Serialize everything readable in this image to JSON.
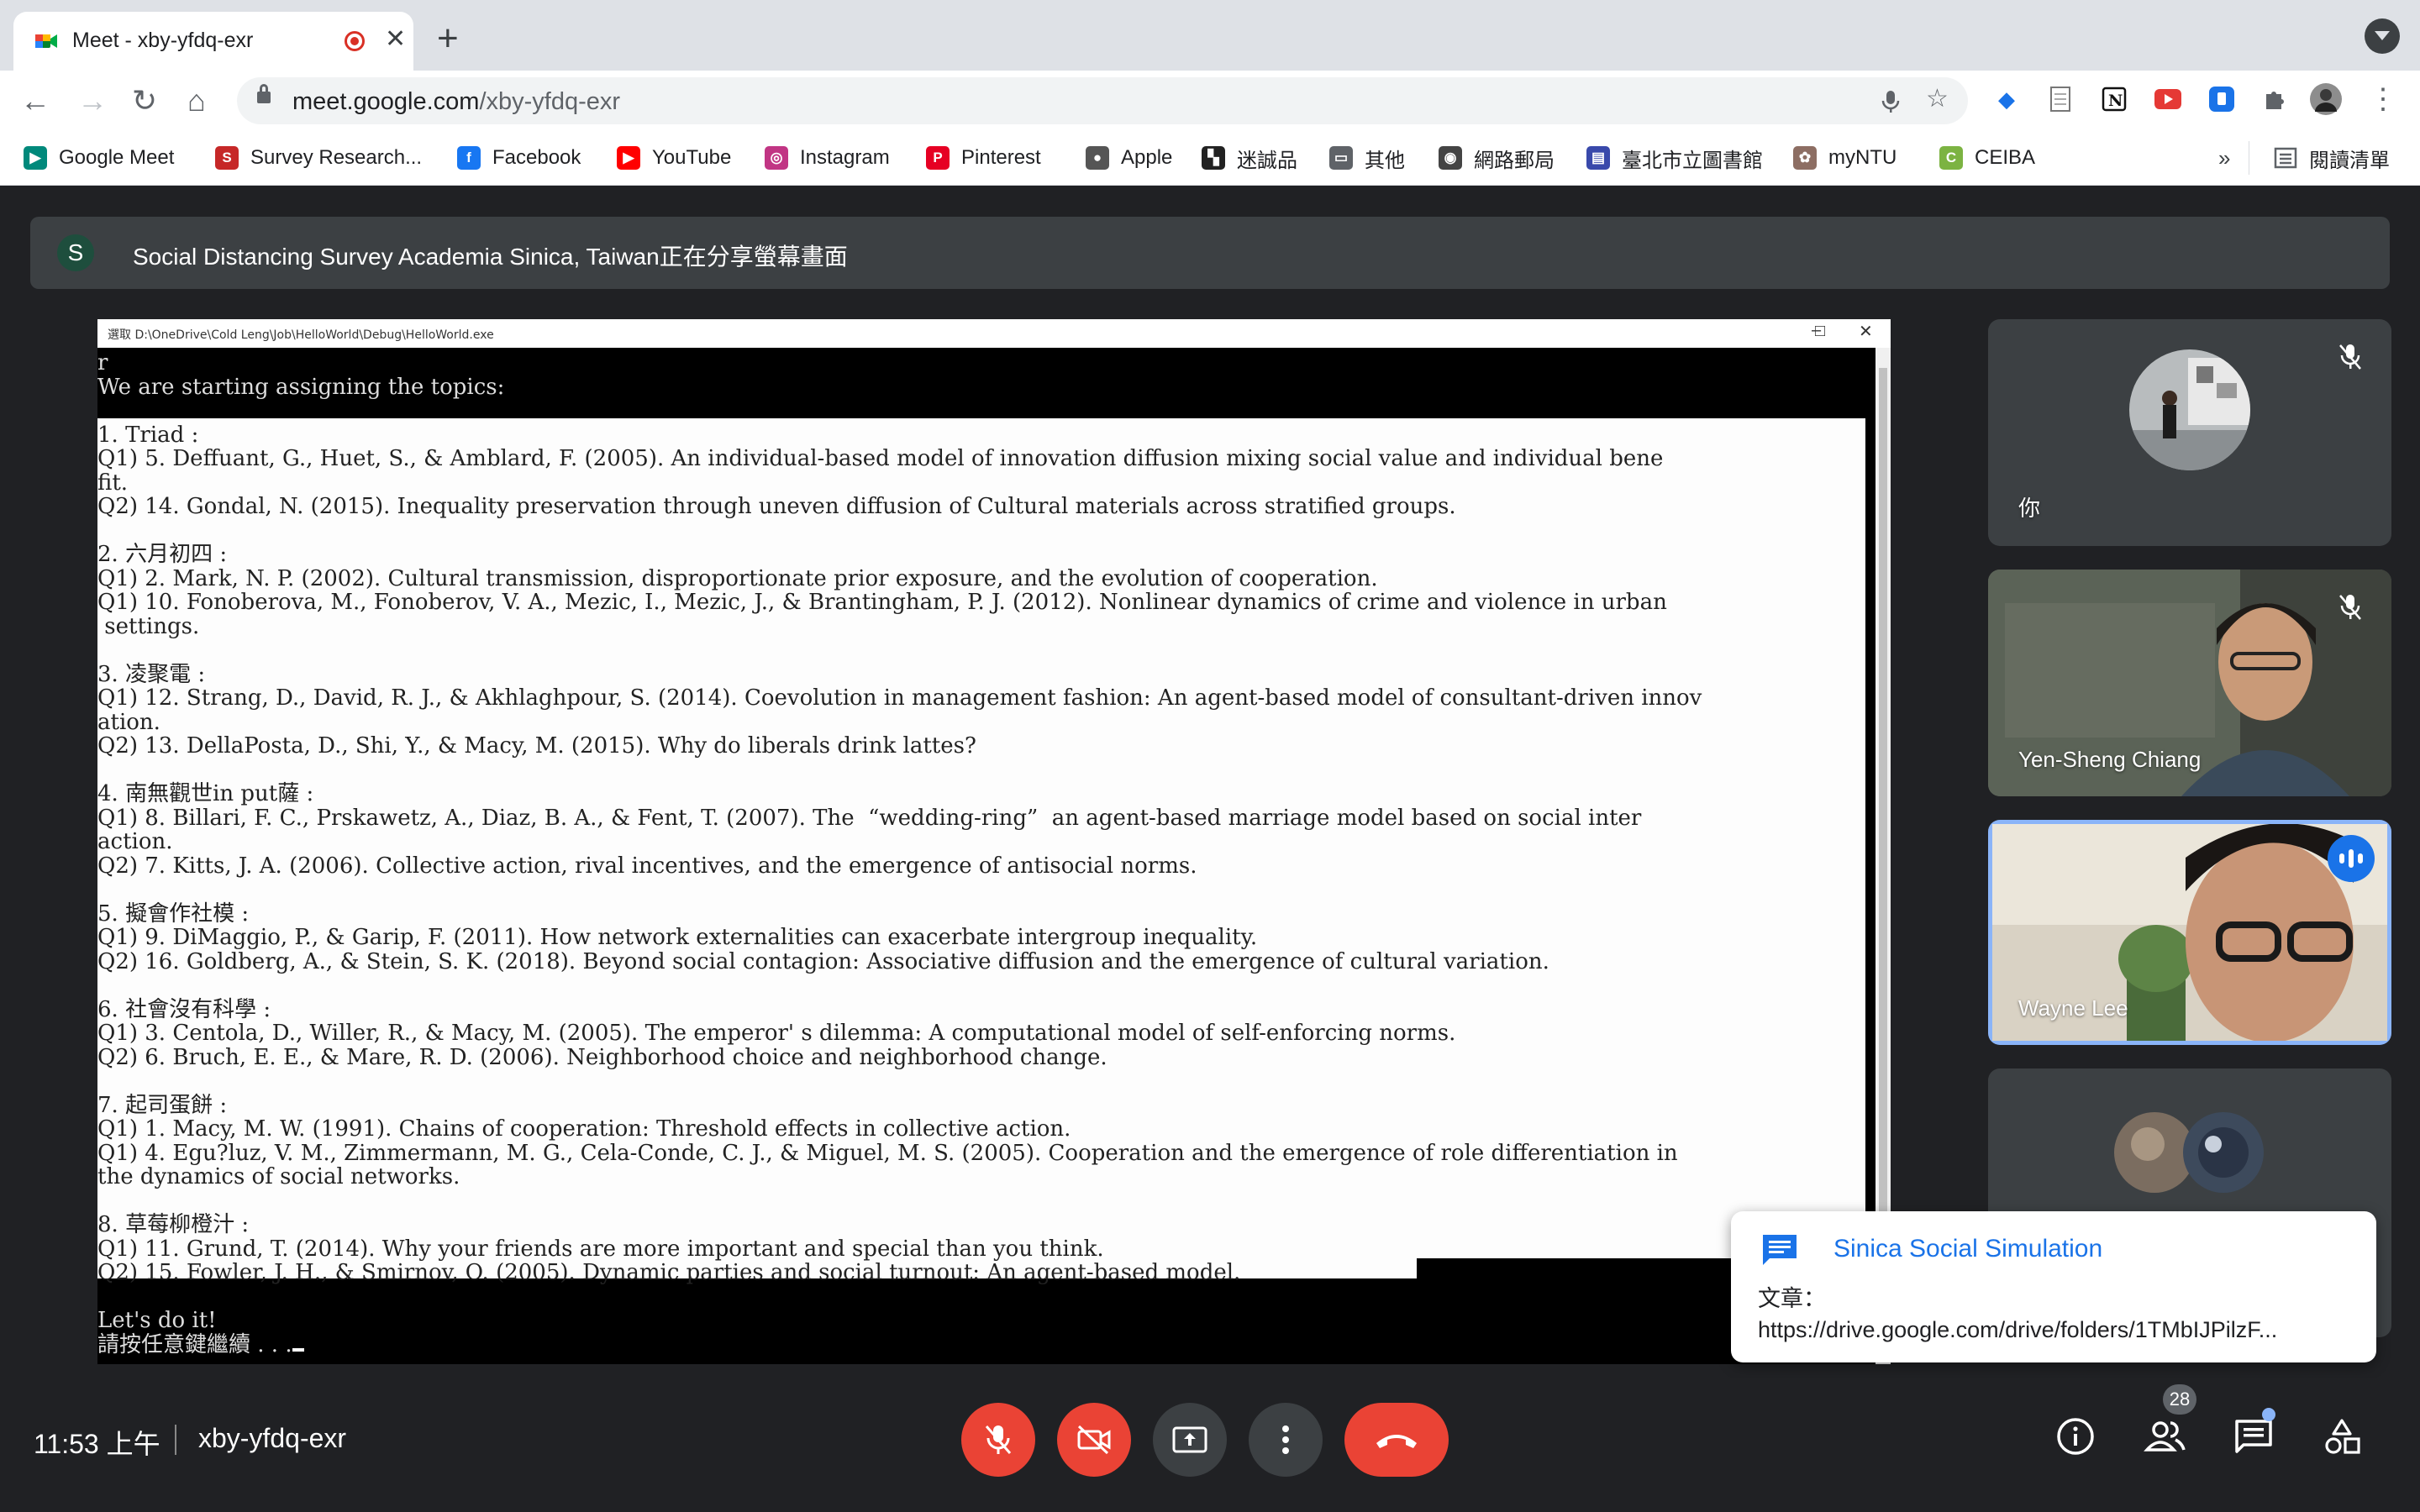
{
  "browser": {
    "tab_title": "Meet - xby-yfdq-exr",
    "new_tab": "+",
    "url_host": "meet.google.com",
    "url_path": "/xby-yfdq-exr"
  },
  "bookmarks": [
    {
      "label": "Google Meet",
      "icon": "meet-icon",
      "color": "#00897b"
    },
    {
      "label": "Survey Research...",
      "icon": "survey-icon",
      "color": "#c62828"
    },
    {
      "label": "Facebook",
      "icon": "facebook-icon",
      "color": "#1877f2"
    },
    {
      "label": "YouTube",
      "icon": "youtube-icon",
      "color": "#ff0000"
    },
    {
      "label": "Instagram",
      "icon": "instagram-icon",
      "color": "#c13584"
    },
    {
      "label": "Pinterest",
      "icon": "pinterest-icon",
      "color": "#e60023"
    },
    {
      "label": "Apple",
      "icon": "apple-icon",
      "color": "#555555"
    },
    {
      "label": "迷誠品",
      "icon": "eslite-icon",
      "color": "#222222"
    },
    {
      "label": "其他",
      "icon": "folder-icon",
      "color": "#5f6368"
    },
    {
      "label": "網路郵局",
      "icon": "globe-icon",
      "color": "#444444"
    },
    {
      "label": "臺北市立圖書館",
      "icon": "library-icon",
      "color": "#3949ab"
    },
    {
      "label": "myNTU",
      "icon": "ntu-icon",
      "color": "#8d6e63"
    },
    {
      "label": "CEIBA",
      "icon": "ceiba-icon",
      "color": "#7cb342"
    }
  ],
  "bookmarks_more": "»",
  "reading_list": "閱讀清單",
  "presentation": {
    "avatar_letter": "S",
    "banner": "Social Distancing Survey Academia Sinica, Taiwan正在分享螢幕畫面"
  },
  "console": {
    "title": "選取 D:\\OneDrive\\Cold Leng\\Job\\HelloWorld\\Debug\\HelloWorld.exe",
    "lines": [
      "r",
      "We are starting assigning the topics:",
      "",
      "1. Triad :",
      "Q1) 5. Deffuant, G., Huet, S., & Amblard, F. (2005). An individual-based model of innovation diffusion mixing social value and individual bene",
      "fit.",
      "Q2) 14. Gondal, N. (2015). Inequality preservation through uneven diffusion of Cultural materials across stratified groups.",
      "",
      "2. 六月初四 :",
      "Q1) 2. Mark, N. P. (2002). Cultural transmission, disproportionate prior exposure, and the evolution of cooperation.",
      "Q1) 10. Fonoberova, M., Fonoberov, V. A., Mezic, I., Mezic, J., & Brantingham, P. J. (2012). Nonlinear dynamics of crime and violence in urban",
      " settings.",
      "",
      "3. 凌聚電 :",
      "Q1) 12. Strang, D., David, R. J., & Akhlaghpour, S. (2014). Coevolution in management fashion: An agent-based model of consultant-driven innov",
      "ation.",
      "Q2) 13. DellaPosta, D., Shi, Y., & Macy, M. (2015). Why do liberals drink lattes?",
      "",
      "4. 南無觀世in put薩 :",
      "Q1) 8. Billari, F. C., Prskawetz, A., Diaz, B. A., & Fent, T. (2007). The  “wedding-ring”  an agent-based marriage model based on social inter",
      "action.",
      "Q2) 7. Kitts, J. A. (2006). Collective action, rival incentives, and the emergence of antisocial norms.",
      "",
      "5. 擬會作社模 :",
      "Q1) 9. DiMaggio, P., & Garip, F. (2011). How network externalities can exacerbate intergroup inequality.",
      "Q2) 16. Goldberg, A., & Stein, S. K. (2018). Beyond social contagion: Associative diffusion and the emergence of cultural variation.",
      "",
      "6. 社會沒有科學 :",
      "Q1) 3. Centola, D., Willer, R., & Macy, M. (2005). The emperor' s dilemma: A computational model of self-enforcing norms.",
      "Q2) 6. Bruch, E. E., & Mare, R. D. (2006). Neighborhood choice and neighborhood change.",
      "",
      "7. 起司蛋餅 :",
      "Q1) 1. Macy, M. W. (1991). Chains of cooperation: Threshold effects in collective action.",
      "Q1) 4. Egu?luz, V. M., Zimmermann, M. G., Cela-Conde, C. J., & Miguel, M. S. (2005). Cooperation and the emergence of role differentiation in",
      "the dynamics of social networks.",
      "",
      "8. 草莓柳橙汁 :",
      "Q1) 11. Grund, T. (2014). Why your friends are more important and special than you think.",
      "Q2) 15. Fowler, J. H., & Smirnov, O. (2005). Dynamic parties and social turnout: An agent-based model.",
      "",
      "Let's do it!",
      "請按任意鍵繼續 . . ."
    ]
  },
  "participants": [
    {
      "name": "你",
      "mic": "muted"
    },
    {
      "name": "Yen-Sheng Chiang",
      "mic": "muted"
    },
    {
      "name": "Wayne Lee",
      "mic": "speaking"
    },
    {
      "name": "",
      "mic": "none"
    }
  ],
  "chat_toast": {
    "title": "Sinica Social Simulation",
    "line1": "文章：",
    "line2": "https://drive.google.com/drive/folders/1TMbIJPilzF..."
  },
  "bottom_bar": {
    "time": "11:53 上午",
    "meeting_code": "xby-yfdq-exr",
    "people_count": "28"
  },
  "colors": {
    "meet_bg": "#202124",
    "danger": "#ea4335",
    "accent": "#1a73e8"
  }
}
